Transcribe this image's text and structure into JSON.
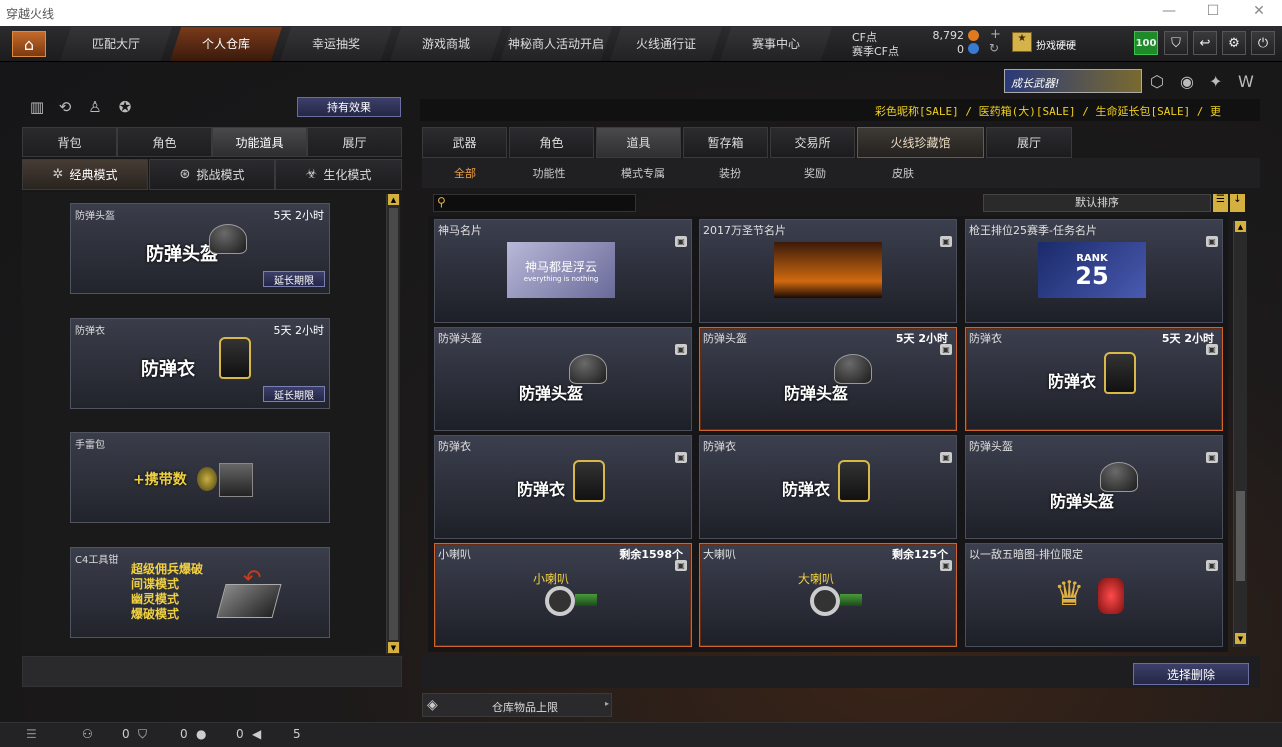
{
  "window": {
    "title": "穿越火线"
  },
  "nav": {
    "tabs": [
      "匹配大厅",
      "个人仓库",
      "幸运抽奖",
      "游戏商城",
      "神秘商人活动开启",
      "火线通行证",
      "赛事中心"
    ],
    "active": 1
  },
  "currency": {
    "cf_label": "CF点",
    "cf_value": "8,792",
    "match_label": "赛季CF点",
    "match_value": "0"
  },
  "rank": {
    "label": "扮戏硬硬"
  },
  "level": "100",
  "top_icons": [
    "shield-icon",
    "back-icon",
    "gear-icon",
    "power-icon"
  ],
  "marquee": "彩色昵称[SALE] / 医药箱(大)[SALE] / 生命延长包[SALE] / 更",
  "grow_banner": "成长武器!",
  "left": {
    "effect_button": "持有效果",
    "tabs": [
      "背包",
      "角色",
      "功能道具",
      "展厅"
    ],
    "active_tab": 2,
    "modes": [
      "经典模式",
      "挑战模式",
      "生化模式"
    ],
    "active_mode": 0,
    "cards": [
      {
        "name": "防弹头盔",
        "time": "5天 2小时",
        "big": "防弹头盔",
        "extend": "延长期限",
        "img": "helmet"
      },
      {
        "name": "防弹衣",
        "time": "5天 2小时",
        "big": "防弹衣",
        "extend": "延长期限",
        "img": "vest"
      },
      {
        "name": "手雷包",
        "time": "",
        "big": "+携带数",
        "extend": "",
        "img": "grenade"
      },
      {
        "name": "C4工具钳",
        "time": "",
        "big": "超级佣兵爆破\n间谍模式\n幽灵模式\n爆破模式",
        "extend": "",
        "img": "c4"
      }
    ]
  },
  "right": {
    "tabs": [
      "武器",
      "角色",
      "道具",
      "暂存箱",
      "交易所",
      "火线珍藏馆",
      "展厅"
    ],
    "active_tab": 2,
    "subtabs": [
      "全部",
      "功能性",
      "模式专属",
      "装扮",
      "奖励",
      "皮肤"
    ],
    "active_sub": 0,
    "search_placeholder": "",
    "sort": "默认排序",
    "items": [
      {
        "name": "神马名片",
        "time": "",
        "banner": "神马都是浮云",
        "banner_sub": "everything is nothing",
        "type": "banner1",
        "hl": false
      },
      {
        "name": "2017万圣节名片",
        "time": "",
        "banner": "",
        "type": "banner2",
        "hl": false
      },
      {
        "name": "枪王排位25赛季-任务名片",
        "time": "",
        "banner": "RANK",
        "banner_sub": "25",
        "type": "banner3",
        "hl": false
      },
      {
        "name": "防弹头盔",
        "time": "",
        "big": "防弹头盔",
        "type": "helmet",
        "hl": false
      },
      {
        "name": "防弹头盔",
        "time": "5天 2小时",
        "big": "防弹头盔",
        "type": "helmet",
        "hl": true
      },
      {
        "name": "防弹衣",
        "time": "5天 2小时",
        "big": "防弹衣",
        "type": "vest",
        "hl": true
      },
      {
        "name": "防弹衣",
        "time": "",
        "big": "防弹衣",
        "type": "vest",
        "hl": false
      },
      {
        "name": "防弹衣",
        "time": "",
        "big": "防弹衣",
        "type": "vest",
        "hl": false
      },
      {
        "name": "防弹头盔",
        "time": "",
        "big": "防弹头盔",
        "type": "helmet",
        "hl": false
      },
      {
        "name": "小喇叭",
        "time": "剩余1598个",
        "big": "小喇叭",
        "type": "horn",
        "hl": true
      },
      {
        "name": "大喇叭",
        "time": "剩余125个",
        "big": "大喇叭",
        "type": "horn",
        "hl": true
      },
      {
        "name": "以一敌五暗图-排位限定",
        "time": "",
        "big": "",
        "type": "trophy",
        "hl": false
      }
    ],
    "delete_button": "选择删除",
    "capacity": "仓库物品上限"
  },
  "status": {
    "counts": [
      "0",
      "0",
      "0",
      "5"
    ]
  }
}
